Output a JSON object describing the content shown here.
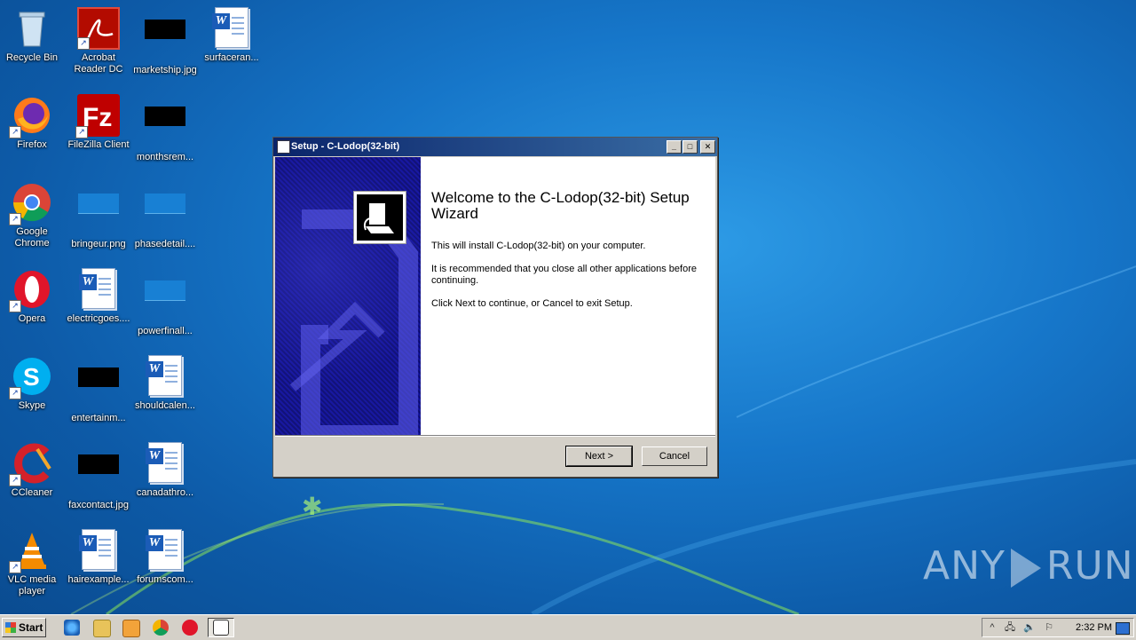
{
  "desktop": {
    "icons": [
      {
        "label": "Recycle Bin",
        "icon": "recycle-bin-icon"
      },
      {
        "label": "Acrobat Reader DC",
        "icon": "acrobat-icon"
      },
      {
        "label": "marketship.jpg",
        "icon": "image-file-icon"
      },
      {
        "label": "surfaceran...",
        "icon": "word-doc-icon"
      },
      {
        "label": "Firefox",
        "icon": "firefox-icon"
      },
      {
        "label": "FileZilla Client",
        "icon": "filezilla-icon"
      },
      {
        "label": "monthsrem...",
        "icon": "image-file-icon"
      },
      {
        "label": "Google Chrome",
        "icon": "chrome-icon"
      },
      {
        "label": "bringeur.png",
        "icon": "image-file-icon"
      },
      {
        "label": "phasedetail....",
        "icon": "image-file-icon"
      },
      {
        "label": "Opera",
        "icon": "opera-icon"
      },
      {
        "label": "electricgoes....",
        "icon": "word-doc-icon"
      },
      {
        "label": "powerfinall...",
        "icon": "image-file-icon"
      },
      {
        "label": "Skype",
        "icon": "skype-icon"
      },
      {
        "label": "entertainm...",
        "icon": "image-file-icon"
      },
      {
        "label": "shouldcalen...",
        "icon": "word-doc-icon"
      },
      {
        "label": "CCleaner",
        "icon": "ccleaner-icon"
      },
      {
        "label": "faxcontact.jpg",
        "icon": "image-file-icon"
      },
      {
        "label": "canadathro...",
        "icon": "word-doc-icon"
      },
      {
        "label": "VLC media player",
        "icon": "vlc-icon"
      },
      {
        "label": "hairexample...",
        "icon": "word-doc-icon"
      },
      {
        "label": "forumscom...",
        "icon": "word-doc-icon"
      }
    ]
  },
  "dialog": {
    "title": "Setup - C-Lodop(32-bit)",
    "heading": "Welcome to the C-Lodop(32-bit) Setup Wizard",
    "line1": "This will install C-Lodop(32-bit) on your computer.",
    "line2": "It is recommended that you close all other applications before continuing.",
    "line3": "Click Next to continue, or Cancel to exit Setup.",
    "next_label": "Next >",
    "cancel_label": "Cancel",
    "minimize": "_",
    "maximize": "□",
    "close": "✕"
  },
  "watermark": {
    "left": "ANY",
    "right": "RUN"
  },
  "taskbar": {
    "start_label": "Start",
    "clock": "2:32 PM",
    "tray_up": "^"
  },
  "colors": {
    "title_bar": "#0a246a",
    "desktop": "#1676c9",
    "wizard_panel": "#1818a0"
  }
}
